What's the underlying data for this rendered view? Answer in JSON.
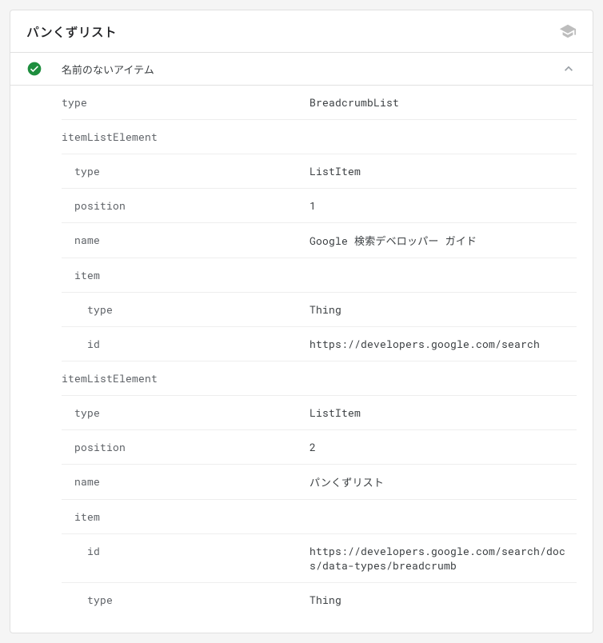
{
  "header": {
    "title": "パンくずリスト"
  },
  "item": {
    "status": "valid",
    "title": "名前のないアイテム"
  },
  "rows": [
    {
      "indent": 0,
      "key": "type",
      "val": "BreadcrumbList"
    },
    {
      "indent": 0,
      "key": "itemListElement",
      "val": ""
    },
    {
      "indent": 1,
      "key": "type",
      "val": "ListItem"
    },
    {
      "indent": 1,
      "key": "position",
      "val": "1"
    },
    {
      "indent": 1,
      "key": "name",
      "val": "Google 検索デベロッパー ガイド"
    },
    {
      "indent": 1,
      "key": "item",
      "val": ""
    },
    {
      "indent": 2,
      "key": "type",
      "val": "Thing"
    },
    {
      "indent": 2,
      "key": "id",
      "val": "https://developers.google.com/search"
    },
    {
      "indent": 0,
      "key": "itemListElement",
      "val": ""
    },
    {
      "indent": 1,
      "key": "type",
      "val": "ListItem"
    },
    {
      "indent": 1,
      "key": "position",
      "val": "2"
    },
    {
      "indent": 1,
      "key": "name",
      "val": "パンくずリスト"
    },
    {
      "indent": 1,
      "key": "item",
      "val": ""
    },
    {
      "indent": 2,
      "key": "id",
      "val": "https://developers.google.com/search/docs/data-types/breadcrumb"
    },
    {
      "indent": 2,
      "key": "type",
      "val": "Thing"
    }
  ]
}
